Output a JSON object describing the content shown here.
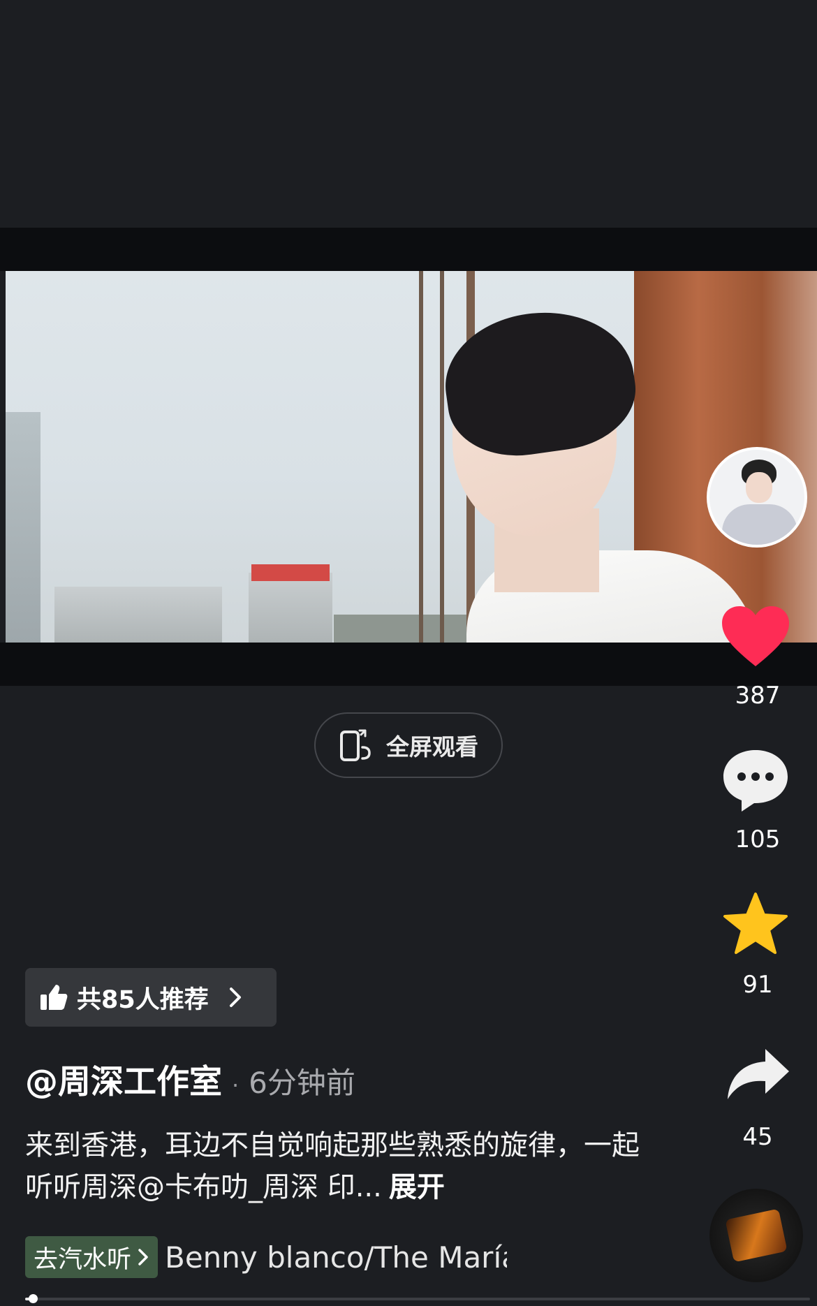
{
  "video": {
    "fullscreen_label": "全屏观看",
    "progress": 0.01
  },
  "actions": {
    "likes": "387",
    "comments": "105",
    "favorites": "91",
    "shares": "45"
  },
  "recommend": {
    "label": "共85人推荐"
  },
  "post": {
    "author": "@周深工作室",
    "time": "6分钟前",
    "description": "来到香港，耳边不自觉响起那些熟悉的旋律，一起听听周深@卡布叻_周深 印...",
    "expand_label": "展开"
  },
  "music": {
    "qishui_label": "去汽水听",
    "song": "Benny blanco/The Marías"
  },
  "colors": {
    "background": "#1c1e22",
    "like": "#fe2c55",
    "favorite": "#ffc41d",
    "qishui_bg": "#3f5a43"
  }
}
